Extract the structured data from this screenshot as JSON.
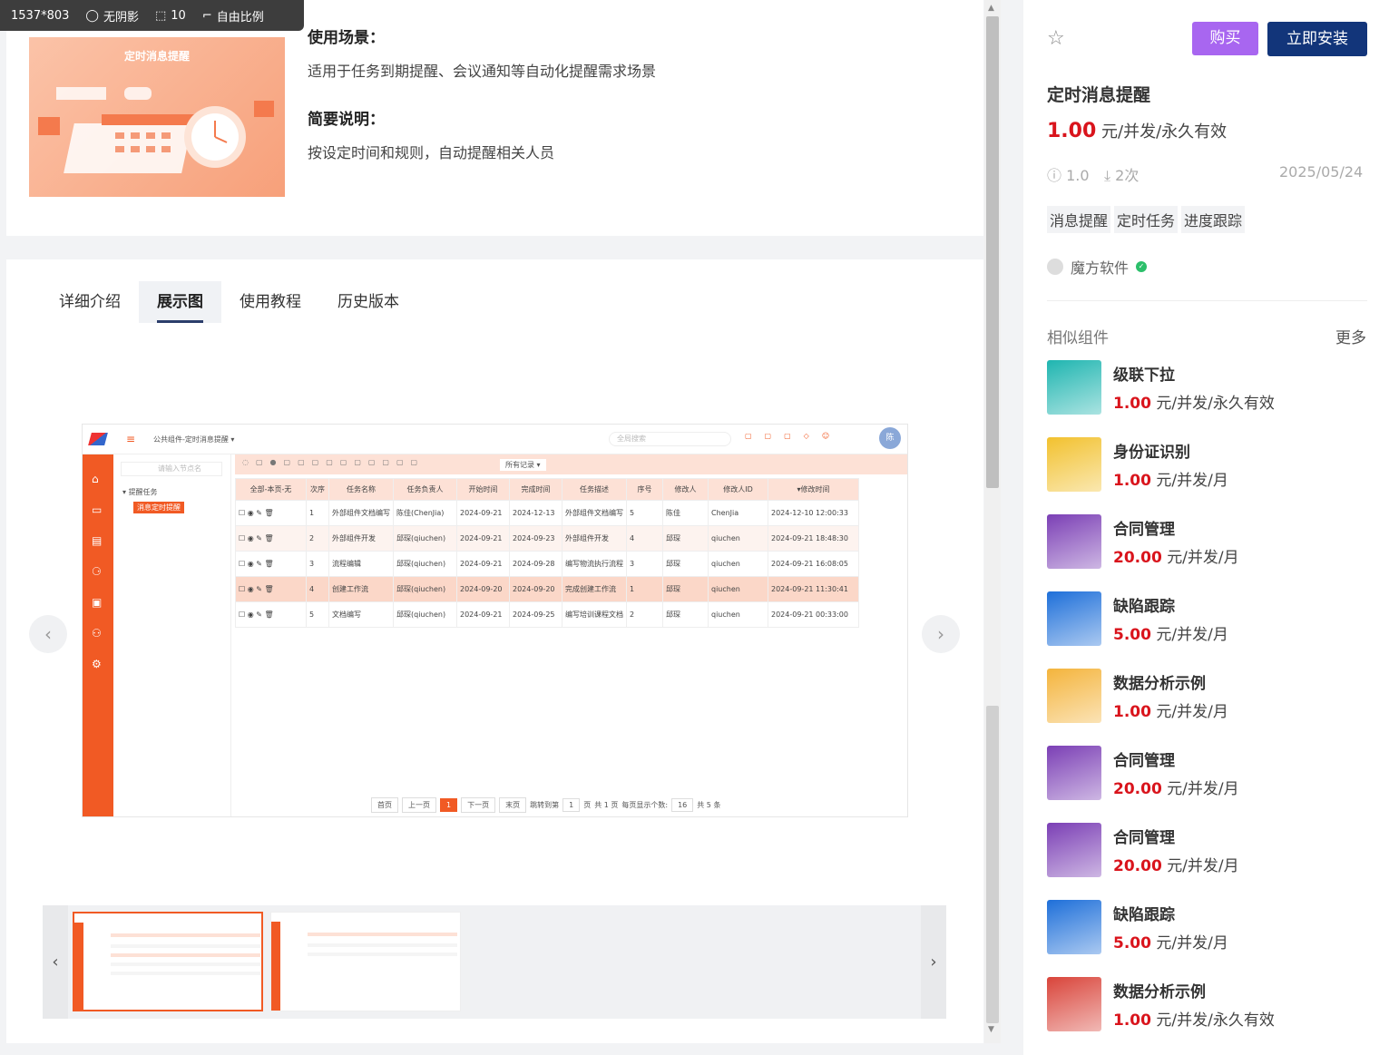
{
  "overlay": {
    "size": "1537*803",
    "shadow": "无阴影",
    "radius": "10",
    "ratio": "自由比例"
  },
  "intro": {
    "banner_title": "定时消息提醒",
    "scene_title": "使用场景：",
    "scene_text": "适用于任务到期提醒、会议通知等自动化提醒需求场景",
    "brief_title": "简要说明：",
    "brief_text": "按设定时间和规则，自动提醒相关人员"
  },
  "tabs": [
    "详细介绍",
    "展示图",
    "使用教程",
    "历史版本"
  ],
  "active_tab": "展示图",
  "shot": {
    "breadcrumb": "公共组件-定时消息提醒",
    "search_placeholder": "全局搜索",
    "avatar": "陈",
    "tree_search": "请输入节点名",
    "tree_root": "提醒任务",
    "tree_child": "消息定时提醒",
    "filter": "所有记录",
    "columns": [
      "全部-本页-无",
      "次序",
      "任务名称",
      "任务负责人",
      "开始时间",
      "完成时间",
      "任务描述",
      "序号",
      "修改人",
      "修改人ID",
      "▾修改时间"
    ],
    "rows": [
      [
        "1",
        "外部组件文档编写",
        "陈佳(ChenJia)",
        "2024-09-21",
        "2024-12-13",
        "外部组件文档编写",
        "5",
        "陈佳",
        "ChenJia",
        "2024-12-10 12:00:33"
      ],
      [
        "2",
        "外部组件开发",
        "邱琛(qiuchen)",
        "2024-09-21",
        "2024-09-23",
        "外部组件开发",
        "4",
        "邱琛",
        "qiuchen",
        "2024-09-21 18:48:30"
      ],
      [
        "3",
        "流程编辑",
        "邱琛(qiuchen)",
        "2024-09-21",
        "2024-09-28",
        "编写物流执行流程",
        "3",
        "邱琛",
        "qiuchen",
        "2024-09-21 16:08:05"
      ],
      [
        "4",
        "创建工作流",
        "邱琛(qiuchen)",
        "2024-09-20",
        "2024-09-20",
        "完成创建工作流",
        "1",
        "邱琛",
        "qiuchen",
        "2024-09-21 11:30:41"
      ],
      [
        "5",
        "文档编写",
        "邱琛(qiuchen)",
        "2024-09-21",
        "2024-09-25",
        "编写培训课程文档",
        "2",
        "邱琛",
        "qiuchen",
        "2024-09-21 00:33:00"
      ]
    ],
    "pager": {
      "first": "首页",
      "prev": "上一页",
      "current": "1",
      "next": "下一页",
      "last": "末页",
      "jump": "跳转到第",
      "page_input": "1",
      "page_unit": "页",
      "total_pages": "共 1 页",
      "page_size_label": "每页显示个数:",
      "page_size": "16",
      "total": "共 5 条"
    }
  },
  "side": {
    "buy": "购买",
    "install": "立即安装",
    "name": "定时消息提醒",
    "price": "1.00",
    "price_unit": "元/并发/永久有效",
    "version": "1.0",
    "downloads": "2次",
    "date": "2025/05/24",
    "tags": [
      "消息提醒",
      "定时任务",
      "进度跟踪"
    ],
    "author": "魔方软件",
    "similar_title": "相似组件",
    "more": "更多",
    "similar": [
      {
        "name": "级联下拉",
        "price": "1.00",
        "unit": "元/并发/永久有效",
        "color": "#1fb5b0"
      },
      {
        "name": "身份证识别",
        "price": "1.00",
        "unit": "元/并发/月",
        "color": "#f2c12e"
      },
      {
        "name": "合同管理",
        "price": "20.00",
        "unit": "元/并发/月",
        "color": "#7b3fb5"
      },
      {
        "name": "缺陷跟踪",
        "price": "5.00",
        "unit": "元/并发/月",
        "color": "#1e6fd9"
      },
      {
        "name": "数据分析示例",
        "price": "1.00",
        "unit": "元/并发/月",
        "color": "#f4b43c"
      },
      {
        "name": "合同管理",
        "price": "20.00",
        "unit": "元/并发/月",
        "color": "#7b3fb5"
      },
      {
        "name": "合同管理",
        "price": "20.00",
        "unit": "元/并发/月",
        "color": "#7b3fb5"
      },
      {
        "name": "缺陷跟踪",
        "price": "5.00",
        "unit": "元/并发/月",
        "color": "#1e6fd9"
      },
      {
        "name": "数据分析示例",
        "price": "1.00",
        "unit": "元/并发/永久有效",
        "color": "#d9443a"
      }
    ]
  }
}
